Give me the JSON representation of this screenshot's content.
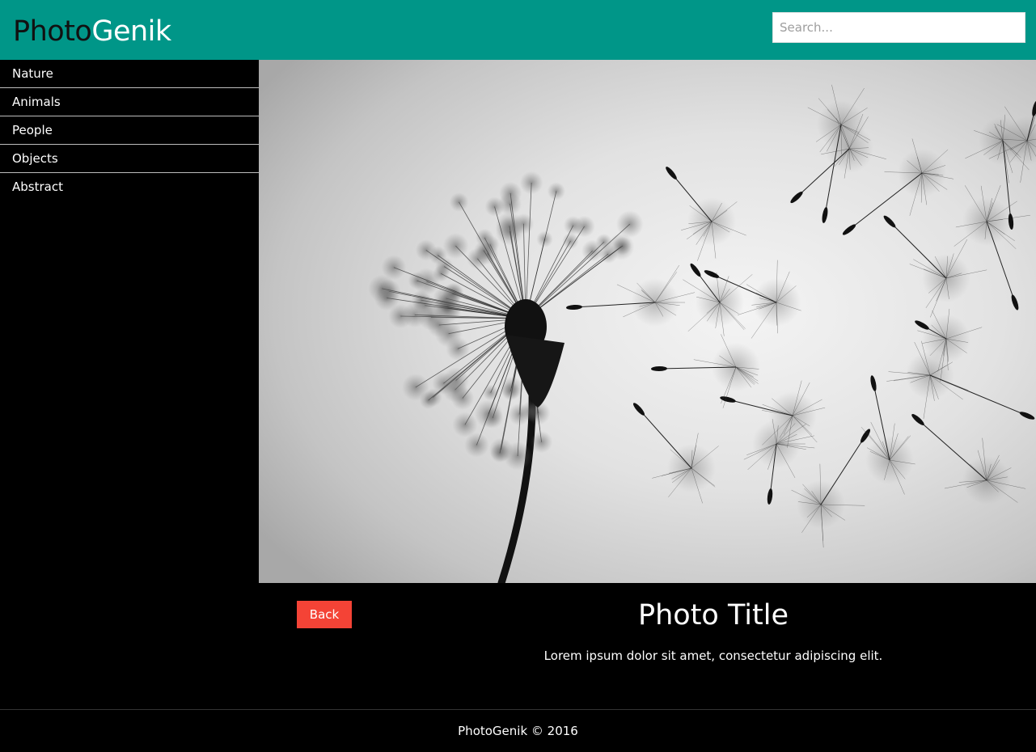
{
  "header": {
    "logo_part1": "Photo",
    "logo_part2": "Genik",
    "search_placeholder": "Search..."
  },
  "sidebar": {
    "items": [
      {
        "label": "Nature"
      },
      {
        "label": "Animals"
      },
      {
        "label": "People"
      },
      {
        "label": "Objects"
      },
      {
        "label": "Abstract"
      }
    ]
  },
  "photo": {
    "title": "Photo Title",
    "description": "Lorem ipsum dolor sit amet, consectetur adipiscing elit.",
    "back_label": "Back"
  },
  "footer": {
    "text": "PhotoGenik © 2016"
  },
  "colors": {
    "header": "#009688",
    "back_button": "#f44336",
    "background": "#000000"
  }
}
